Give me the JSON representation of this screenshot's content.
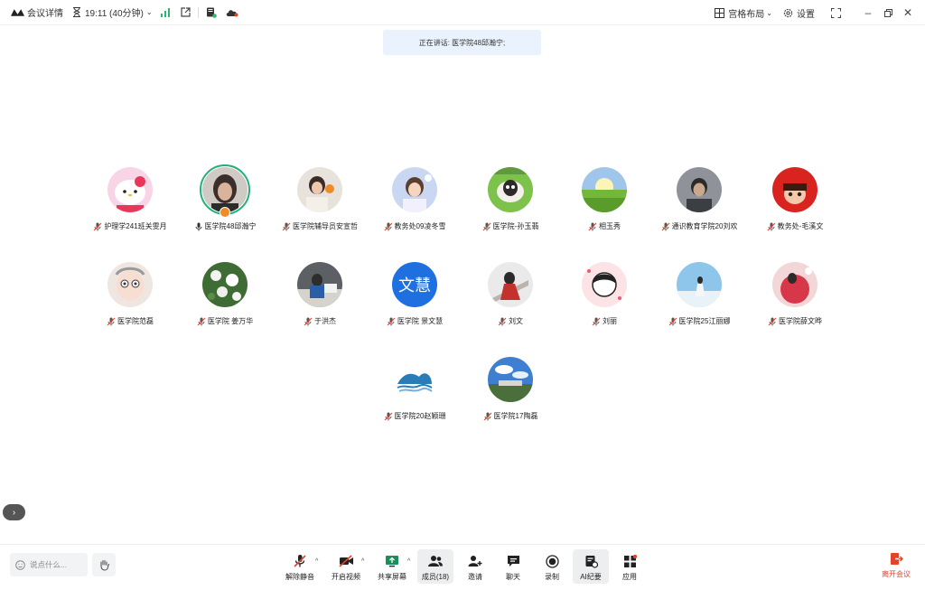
{
  "topbar": {
    "meeting_details": "会议详情",
    "timer": "19:11 (40分钟)",
    "layout": "宫格布局",
    "settings": "设置"
  },
  "speaking": {
    "text": "正在讲话: 医学院48邱瀚宁;"
  },
  "participants": [
    {
      "name": "护理学241班关雯月",
      "muted": true
    },
    {
      "name": "医学院48邱瀚宁",
      "muted": false,
      "speaking": true
    },
    {
      "name": "医学院辅导员安宣哲",
      "muted": true
    },
    {
      "name": "教务处09凌冬雪",
      "muted": true
    },
    {
      "name": "医学院-孙玉翡",
      "muted": true
    },
    {
      "name": "相玉秀",
      "muted": true
    },
    {
      "name": "通识教育学院20刘欢",
      "muted": true
    },
    {
      "name": "教务处-毛溪文",
      "muted": true
    },
    {
      "name": "医学院范磊",
      "muted": true
    },
    {
      "name": "医学院 姜万华",
      "muted": true
    },
    {
      "name": "于洪杰",
      "muted": true
    },
    {
      "name": "医学院 景文慧",
      "muted": true,
      "avatar_text": "文慧"
    },
    {
      "name": "刘文",
      "muted": true
    },
    {
      "name": "刘丽",
      "muted": true
    },
    {
      "name": "医学院25江丽娜",
      "muted": true
    },
    {
      "name": "医学院薛文晔",
      "muted": true
    },
    {
      "name": "医学院20赵颖珊",
      "muted": true
    },
    {
      "name": "医学院17陶磊",
      "muted": true
    }
  ],
  "bottombar": {
    "chat_placeholder": "说点什么...",
    "tools": {
      "unmute": "解除静音",
      "video": "开启视频",
      "share": "共享屏幕",
      "members": "成员(18)",
      "invite": "邀请",
      "chat": "聊天",
      "record": "录制",
      "ai": "AI纪要",
      "apps": "应用"
    },
    "leave": "离开会议"
  },
  "colors": {
    "accent": "#22b07d",
    "leave": "#e0452b",
    "blue": "#1e6fe0"
  }
}
